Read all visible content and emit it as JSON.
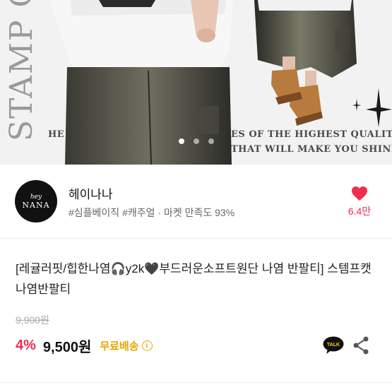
{
  "hero": {
    "stamp_text": "STAMP C",
    "caption_left": "HE",
    "caption_line1": "ES OF THE HIGHEST QUALITY.",
    "caption_line2": "THAT WILL MAKE YOU SHINE.",
    "carousel": {
      "count": 3,
      "active_index": 0
    }
  },
  "seller": {
    "avatar_line1": "hey",
    "avatar_line2": "NANA",
    "name": "헤이나나",
    "tags": "#심플베이직 #캐주얼 · 마켓 만족도 93%",
    "like_count": "6.4만"
  },
  "product": {
    "title": "[레귤러핏/힙한나염🎧y2k🖤부드러운소프트원단 나염 반팔티] 스템프캣나염반팔티",
    "original_price": "9,900원",
    "discount": "4%",
    "price": "9,500원",
    "shipping": "무료배송",
    "info_icon": "i",
    "talk_label": "TALK"
  },
  "colors": {
    "accent_red": "#ef2d4c",
    "shipping_yellow": "#e6a800",
    "talk_yellow": "#f5d31d"
  }
}
